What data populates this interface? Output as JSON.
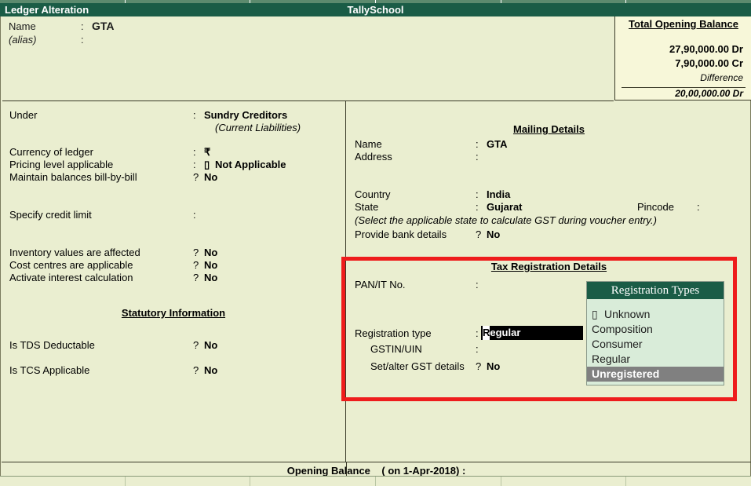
{
  "window": {
    "screen_title": "Ledger Alteration",
    "company_title": "TallySchool"
  },
  "header": {
    "name_label": "Name",
    "name_sep": ":",
    "name_value": "GTA",
    "alias_label": "(alias)",
    "alias_sep": ":",
    "alias_value": ""
  },
  "total_opening_balance": {
    "title": "Total Opening Balance",
    "debit": "27,90,000.00 Dr",
    "credit": "7,90,000.00 Cr",
    "difference_label": "Difference",
    "difference_value": "20,00,000.00 Dr"
  },
  "left": {
    "under": {
      "label": "Under",
      "sep": ":",
      "value": "Sundry Creditors",
      "sub": "(Current Liabilities)"
    },
    "currency": {
      "label": "Currency of ledger",
      "sep": ":",
      "value": "₹"
    },
    "pricing_level": {
      "label": "Pricing level applicable",
      "sep": ":",
      "marker": "▯",
      "value": "Not Applicable"
    },
    "bill_by_bill": {
      "label": "Maintain balances bill-by-bill",
      "sep": "?",
      "value": "No"
    },
    "credit_limit": {
      "label": "Specify credit limit",
      "sep": ":",
      "value": ""
    },
    "inventory_values": {
      "label": "Inventory values are affected",
      "sep": "?",
      "value": "No"
    },
    "cost_centres": {
      "label": "Cost centres are applicable",
      "sep": "?",
      "value": "No"
    },
    "interest_calc": {
      "label": "Activate interest calculation",
      "sep": "?",
      "value": "No"
    },
    "statutory_title": "Statutory Information",
    "tds": {
      "label": "Is TDS Deductable",
      "sep": "?",
      "value": "No"
    },
    "tcs": {
      "label": "Is TCS Applicable",
      "sep": "?",
      "value": "No"
    }
  },
  "mailing": {
    "title": "Mailing Details",
    "name": {
      "label": "Name",
      "sep": ":",
      "value": "GTA"
    },
    "address": {
      "label": "Address",
      "sep": ":",
      "value": ""
    },
    "country": {
      "label": "Country",
      "sep": ":",
      "value": "India"
    },
    "state": {
      "label": "State",
      "sep": ":",
      "value": "Gujarat"
    },
    "pincode": {
      "label": "Pincode",
      "sep": ":",
      "value": ""
    },
    "hint": "(Select the applicable state to calculate GST during voucher entry.)",
    "bank_details": {
      "label": "Provide bank details",
      "sep": "?",
      "value": "No"
    }
  },
  "tax": {
    "title": "Tax Registration Details",
    "pan": {
      "label": "PAN/IT No.",
      "sep": ":",
      "value": ""
    },
    "registration_type": {
      "label": "Registration type",
      "sep": ":",
      "value": "Regular",
      "caret_char": "R",
      "rest": "egular"
    },
    "gstin": {
      "label": "GSTIN/UIN",
      "sep": ":",
      "value": ""
    },
    "set_alter_gst": {
      "label": "Set/alter GST details",
      "sep": "?",
      "value": "No"
    }
  },
  "registration_types_dropdown": {
    "title": "Registration Types",
    "items": [
      {
        "marker": "▯",
        "label": "Unknown",
        "selected": false
      },
      {
        "marker": "",
        "label": "Composition",
        "selected": false
      },
      {
        "marker": "",
        "label": "Consumer",
        "selected": false
      },
      {
        "marker": "",
        "label": "Regular",
        "selected": false
      },
      {
        "marker": "",
        "label": "Unregistered",
        "selected": true
      }
    ]
  },
  "footer": {
    "opening_balance_label": "Opening Balance",
    "opening_balance_date": "( on 1-Apr-2018) :"
  },
  "colors": {
    "title_bar": "#1a5c46",
    "page_bg": "#eaeed0",
    "highlight_red": "#ee1c1c",
    "dropdown_bg": "#d9ecd9",
    "selected_row": "#808080",
    "balance_box_bg": "#f7f7d9"
  }
}
